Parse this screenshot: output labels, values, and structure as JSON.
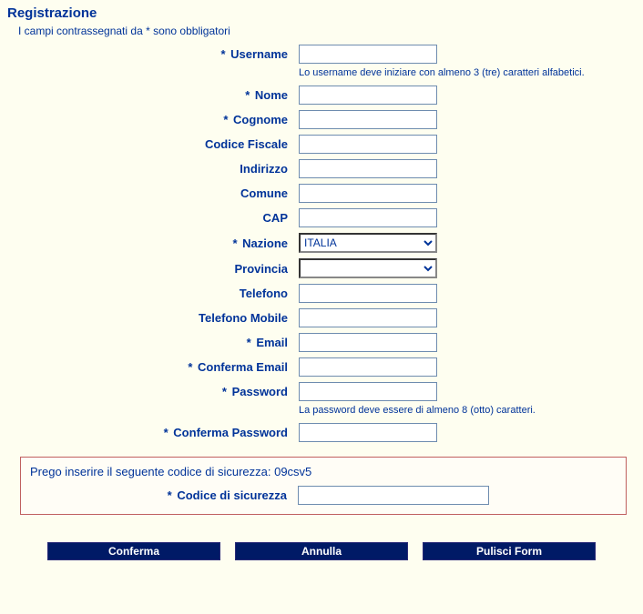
{
  "title": "Registrazione",
  "required_note": "I campi contrassegnati da * sono obbligatori",
  "req_marker": "*",
  "fields": {
    "username": {
      "label": "Username",
      "value": "",
      "required": true
    },
    "username_hint": "Lo username deve iniziare con almeno 3 (tre) caratteri alfabetici.",
    "nome": {
      "label": "Nome",
      "value": "",
      "required": true
    },
    "cognome": {
      "label": "Cognome",
      "value": "",
      "required": true
    },
    "codice_fiscale": {
      "label": "Codice Fiscale",
      "value": "",
      "required": false
    },
    "indirizzo": {
      "label": "Indirizzo",
      "value": "",
      "required": false
    },
    "comune": {
      "label": "Comune",
      "value": "",
      "required": false
    },
    "cap": {
      "label": "CAP",
      "value": "",
      "required": false
    },
    "nazione": {
      "label": "Nazione",
      "value": "ITALIA",
      "required": true
    },
    "provincia": {
      "label": "Provincia",
      "value": "",
      "required": false
    },
    "telefono": {
      "label": "Telefono",
      "value": "",
      "required": false
    },
    "telefono_mobile": {
      "label": "Telefono Mobile",
      "value": "",
      "required": false
    },
    "email": {
      "label": "Email",
      "value": "",
      "required": true
    },
    "conferma_email": {
      "label": "Conferma Email",
      "value": "",
      "required": true
    },
    "password": {
      "label": "Password",
      "value": "",
      "required": true
    },
    "password_hint": "La password deve essere di almeno 8 (otto) caratteri.",
    "conferma_password": {
      "label": "Conferma Password",
      "value": "",
      "required": true
    }
  },
  "security": {
    "prompt_prefix": "Prego inserire il seguente codice di sicurezza: ",
    "code": "09csv5",
    "label": "Codice di sicurezza",
    "value": ""
  },
  "buttons": {
    "confirm": "Conferma",
    "cancel": "Annulla",
    "reset": "Pulisci Form"
  }
}
